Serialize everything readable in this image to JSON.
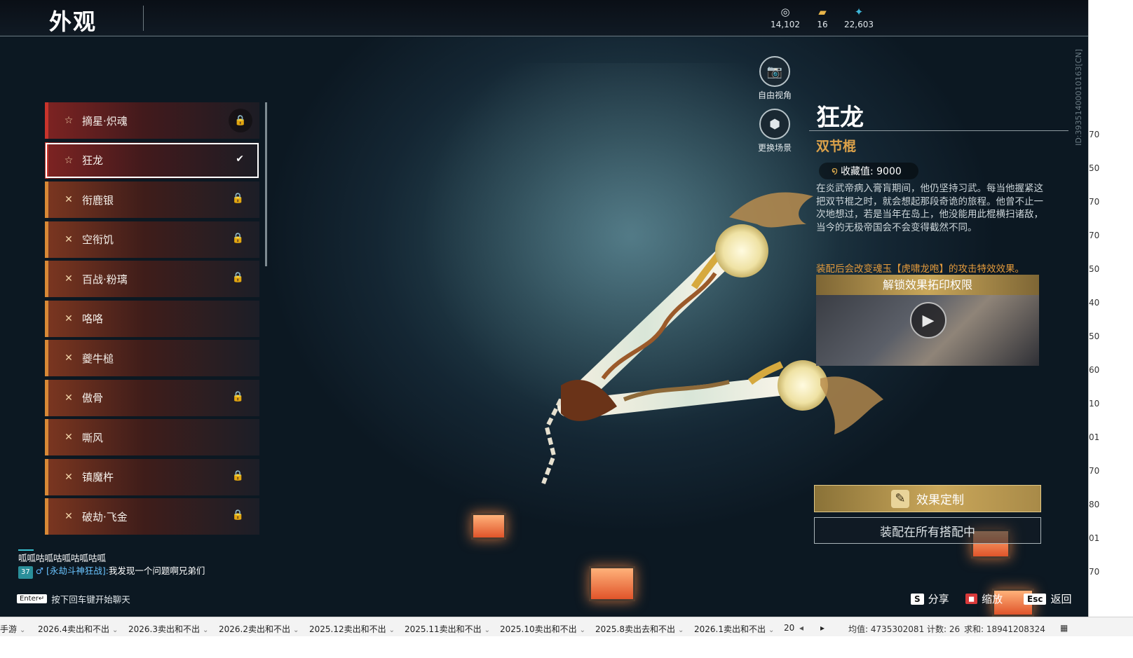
{
  "header": {
    "title": "外观",
    "currencies": [
      {
        "icon": "jade-coin-icon",
        "glyph": "◎",
        "value": "14,102"
      },
      {
        "icon": "gold-ingot-icon",
        "glyph": "▰",
        "value": "16"
      },
      {
        "icon": "feather-icon",
        "glyph": "✦",
        "value": "22,603"
      }
    ]
  },
  "side_id": "ID:39351400010163[CN]",
  "camera": {
    "free_view_label": "自由视角",
    "change_scene_label": "更换场景"
  },
  "skin_list": [
    {
      "name": "摘星·炽魂",
      "icon": "star-outline-icon",
      "status": "lock",
      "rarity": "red"
    },
    {
      "name": "狂龙",
      "icon": "star-outline-icon",
      "status": "equipped",
      "rarity": "red",
      "selected": true
    },
    {
      "name": "衔鹿银",
      "icon": "cross-arrows-icon",
      "status": "lock",
      "rarity": "gold"
    },
    {
      "name": "空衔饥",
      "icon": "cross-arrows-icon",
      "status": "lock",
      "rarity": "gold"
    },
    {
      "name": "百战·粉璃",
      "icon": "cross-arrows-icon",
      "status": "lock",
      "rarity": "gold"
    },
    {
      "name": "咯咯",
      "icon": "cross-arrows-icon",
      "status": "none",
      "rarity": "gold"
    },
    {
      "name": "夔牛槌",
      "icon": "cross-arrows-icon",
      "status": "none",
      "rarity": "gold"
    },
    {
      "name": "傲骨",
      "icon": "cross-arrows-icon",
      "status": "lock",
      "rarity": "gold"
    },
    {
      "name": "嘶风",
      "icon": "cross-arrows-icon",
      "status": "none",
      "rarity": "gold"
    },
    {
      "name": "镇魔杵",
      "icon": "cross-arrows-icon",
      "status": "lock",
      "rarity": "gold"
    },
    {
      "name": "破劫·飞金",
      "icon": "cross-arrows-icon",
      "status": "lock",
      "rarity": "gold"
    }
  ],
  "detail": {
    "name": "狂龙",
    "type": "双节棍",
    "collection_label": "收藏值: 9000",
    "description": "在炎武帝病入膏肓期间，他仍坚持习武。每当他握紧这把双节棍之时，就会想起那段奇诡的旅程。他曾不止一次地想过，若是当年在岛上，他没能用此棍横扫诸敌，当今的无极帝国会不会变得截然不同。",
    "effect_note": "装配后会改变魂玉【虎啸龙咆】的攻击特效效果。",
    "unlock_header": "解锁效果拓印权限",
    "custom_button": "效果定制",
    "equip_button": "装配在所有搭配中"
  },
  "chat": {
    "line1": "呱呱咕呱咕呱咕呱咕呱",
    "badge": "37",
    "channel": "[永劫斗神狂战]:",
    "message": "我发现一个问题啊兄弟们",
    "hint_key": "Enter↵",
    "hint": "按下回车键开始聊天"
  },
  "hotkeys": [
    {
      "key": "S",
      "label": "分享",
      "style": "white"
    },
    {
      "key": "◼",
      "label": "缩放",
      "style": "red"
    },
    {
      "key": "Esc",
      "label": "返回",
      "style": "white"
    }
  ],
  "sheet": {
    "tabs": [
      "手游",
      "2026.4卖出和不出",
      "2026.3卖出和不出",
      "2026.2卖出和不出",
      "2025.12卖出和不出",
      "2025.11卖出和不出",
      "2025.10卖出和不出",
      "2025.8卖出去和不出",
      "2026.1卖出和不出",
      "20"
    ],
    "avg": "均值: 4735302081",
    "count": "计数: 26",
    "sum": "求和: 18941208324"
  },
  "right_cells": [
    "70",
    "50",
    "70",
    "70",
    "50",
    "40",
    "50",
    "60",
    "10",
    "01",
    "70",
    "80",
    "01",
    "70"
  ]
}
